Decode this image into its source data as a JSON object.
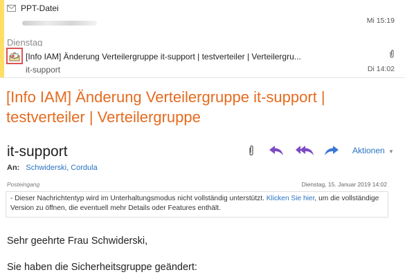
{
  "mail_list": {
    "items": [
      {
        "title": "PPT-Datei",
        "time": "Mi 15:19"
      },
      {
        "subject": "[Info IAM] Änderung Verteilergruppe it-support | testverteiler | Verteilergru...",
        "sender": "it-support",
        "time": "Di 14:02",
        "attachment_icon": "paperclip-icon"
      }
    ],
    "group_header": "Dienstag"
  },
  "message": {
    "subject": "[Info IAM] Änderung Verteilergruppe it-support | testverteiler | Verteilergruppe",
    "sender": "it-support",
    "to_label": "An:",
    "to_value": "Schwiderski, Cordula",
    "folder": "Posteingang",
    "date": "Dienstag, 15. Januar 2019 14:02",
    "actions_label": "Aktionen",
    "info_prefix": "- Dieser Nachrichtentyp wird im Unterhaltungsmodus nicht vollständig unterstützt.",
    "info_link": "Klicken Sie hier",
    "info_suffix": ", um die vollständige Version zu öffnen, die eventuell mehr Details oder Features enthält.",
    "body_line1": "Sehr geehrte Frau Schwiderski,",
    "body_line2": "Sie haben die Sicherheitsgruppe geändert:"
  },
  "colors": {
    "subject": "#e56b1f",
    "link": "#2b73c4",
    "reply_icon": "#7d4bc4",
    "forward_icon": "#3a78d4",
    "selection_box": "#e05050"
  }
}
